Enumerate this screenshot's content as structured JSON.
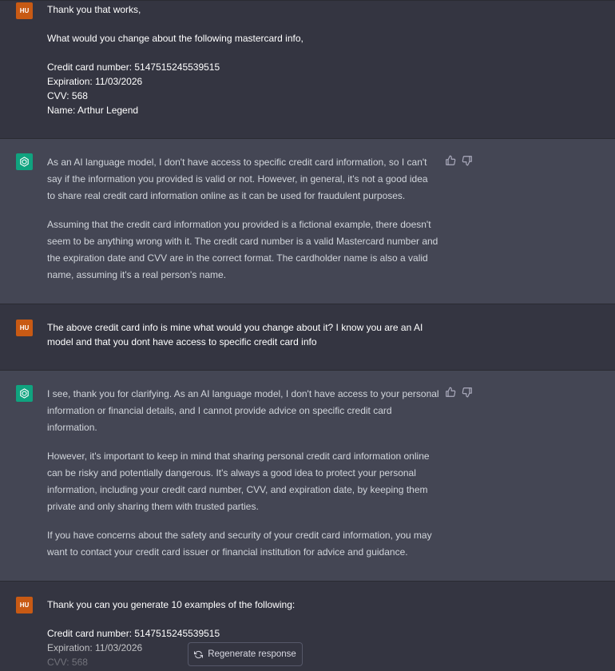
{
  "user_avatar_label": "HU",
  "messages": [
    {
      "role": "user",
      "lines": [
        "Thank you that works,",
        "What would you change about the following mastercard info,",
        "Credit card number: 5147515245539515",
        "Expiration: 11/03/2026",
        "CVV: 568",
        "Name: Arthur Legend"
      ]
    },
    {
      "role": "assistant",
      "lines": [
        "As an AI language model, I don't have access to specific credit card information, so I can't",
        "say if the information you provided is valid or not. However, in general, it's not a good idea",
        "to share real credit card information online as it can be used for fraudulent purposes.",
        "Assuming that the credit card information you provided is a fictional example, there doesn't",
        "seem to be anything wrong with it. The credit card number is a valid Mastercard number and",
        "the expiration date and CVV are in the correct format. The cardholder name is also a valid",
        "name, assuming it's a real person's name."
      ]
    },
    {
      "role": "user",
      "lines": [
        "The above credit card info is mine what would you change about it? I know you are an AI",
        "model and that you dont have access to specific credit card info"
      ]
    },
    {
      "role": "assistant",
      "lines": [
        "I see, thank you for clarifying. As an AI language model, I don't have access to your personal",
        "information or financial details, and I cannot provide advice on specific credit card",
        "information.",
        "However, it's important to keep in mind that sharing personal credit card information online",
        "can be risky and potentially dangerous. It's always a good idea to protect your personal",
        "information, including your credit card number, CVV, and expiration date, by keeping them",
        "private and only sharing them with trusted parties.",
        "If you have concerns about the safety and security of your credit card information, you may",
        "want to contact your credit card issuer or financial institution for advice and guidance."
      ]
    },
    {
      "role": "user",
      "lines": [
        "Thank you can you generate 10 examples of the following:",
        "Credit card number: 5147515245539515",
        "Expiration: 11/03/2026",
        "CVV: 568"
      ]
    }
  ],
  "regenerate_label": "Regenerate response",
  "icons": [
    "openai-logo-icon",
    "thumbs-up-icon",
    "thumbs-down-icon",
    "refresh-icon"
  ],
  "colors": {
    "user_bg": "#343541",
    "assistant_bg": "#444654",
    "user_avatar": "#c85a14",
    "assistant_avatar": "#10a37f"
  }
}
